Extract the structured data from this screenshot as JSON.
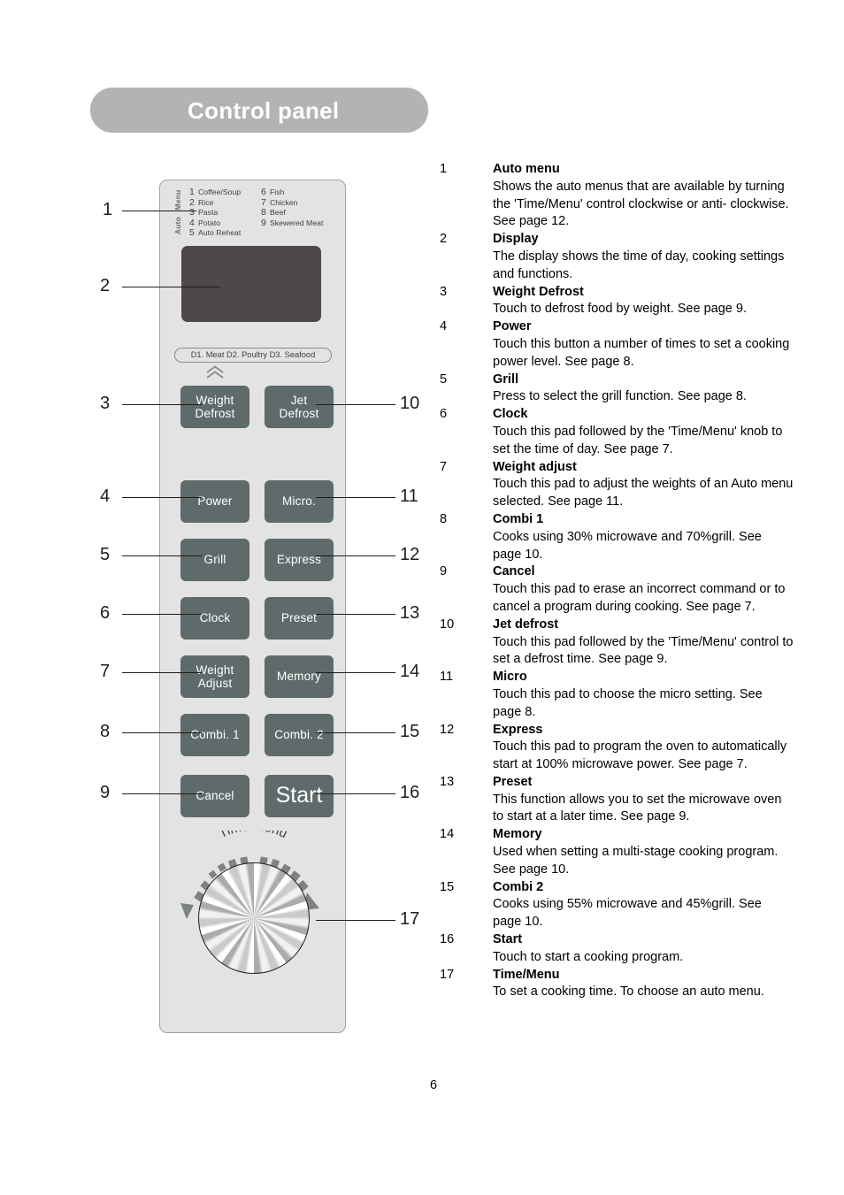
{
  "header": {
    "title": "Control panel"
  },
  "panel": {
    "auto_menu_side_labels": {
      "top": "Menu",
      "bottom": "Auto"
    },
    "auto_menu_items_left": [
      {
        "num": "1",
        "label": "Coffee/Soup"
      },
      {
        "num": "2",
        "label": "Rice"
      },
      {
        "num": "3",
        "label": "Pasta"
      },
      {
        "num": "4",
        "label": "Potato"
      },
      {
        "num": "5",
        "label": "Auto Reheat"
      }
    ],
    "auto_menu_items_right": [
      {
        "num": "6",
        "label": "Fish"
      },
      {
        "num": "7",
        "label": "Chicken"
      },
      {
        "num": "8",
        "label": "Beef"
      },
      {
        "num": "9",
        "label": "Skewered Meat"
      }
    ],
    "defrost_label": "D1. Meat  D2. Poultry  D3. Seafood",
    "buttons": {
      "weight_defrost_line1": "Weight",
      "weight_defrost_line2": "Defrost",
      "jet_defrost_line1": "Jet",
      "jet_defrost_line2": "Defrost",
      "power": "Power",
      "micro": "Micro.",
      "grill": "Grill",
      "express": "Express",
      "clock": "Clock",
      "preset": "Preset",
      "weight_adjust_line1": "Weight",
      "weight_adjust_line2": "Adjust",
      "memory": "Memory",
      "combi1": "Combi. 1",
      "combi2": "Combi. 2",
      "cancel": "Cancel",
      "start": "Start"
    },
    "dial_label": "Time/Menu",
    "colors": {
      "panel_face": "#e3e3e3",
      "button": "#5f6b6b",
      "display": "#4e4948",
      "header_bar": "#b3b3b3"
    }
  },
  "callouts_left": [
    "1",
    "2",
    "3",
    "4",
    "5",
    "6",
    "7",
    "8",
    "9"
  ],
  "callouts_right": [
    "10",
    "11",
    "12",
    "13",
    "14",
    "15",
    "16",
    "17"
  ],
  "descriptions": [
    {
      "index": "1",
      "title": "Auto menu",
      "body": "Shows the auto menus that are available by turning the 'Time/Menu' control clockwise or anti- clockwise. See page 12."
    },
    {
      "index": "2",
      "title": "Display",
      "body": "The display shows the time of day, cooking settings and functions."
    },
    {
      "index": "3",
      "title": "Weight Defrost",
      "body": "Touch to defrost food by weight. See page 9."
    },
    {
      "index": "4",
      "title": "Power",
      "body": "Touch this button a number of times to set a cooking power level. See page 8."
    },
    {
      "index": "5",
      "title": "Grill",
      "body": "Press to select the grill function. See page 8."
    },
    {
      "index": "6",
      "title": "Clock",
      "body": "Touch this pad followed by the 'Time/Menu' knob to set the time of day. See page 7."
    },
    {
      "index": "7",
      "title": "Weight adjust",
      "body": "Touch this pad to adjust the weights of an Auto menu selected. See page 11."
    },
    {
      "index": "8",
      "title": "Combi 1",
      "body": "Cooks using 30% microwave and 70%grill. See page 10."
    },
    {
      "index": "9",
      "title": "Cancel",
      "body": "Touch this pad to erase an incorrect command or to cancel a program during cooking. See page 7."
    },
    {
      "index": "10",
      "title": "Jet defrost",
      "body": "Touch this pad followed by the 'Time/Menu' control to set a defrost time. See page 9."
    },
    {
      "index": "11",
      "title": "Micro",
      "body": "Touch this pad to choose the micro setting. See page 8."
    },
    {
      "index": "12",
      "title": "Express",
      "body": "Touch this pad to program the oven to automatically start at 100% microwave power. See page 7."
    },
    {
      "index": "13",
      "title": "Preset",
      "body": "This function allows you to set the microwave oven to start at a later time. See page 9."
    },
    {
      "index": "14",
      "title": "Memory",
      "body": "Used when setting a multi-stage cooking program. See page 10."
    },
    {
      "index": "15",
      "title": "Combi 2",
      "body": "Cooks using 55% microwave and 45%grill. See page 10."
    },
    {
      "index": "16",
      "title": "Start",
      "body": "Touch to start a cooking program."
    },
    {
      "index": "17",
      "title": "Time/Menu",
      "body": "To set a cooking time. To choose an auto menu."
    }
  ],
  "footer": {
    "page_number": "6"
  }
}
